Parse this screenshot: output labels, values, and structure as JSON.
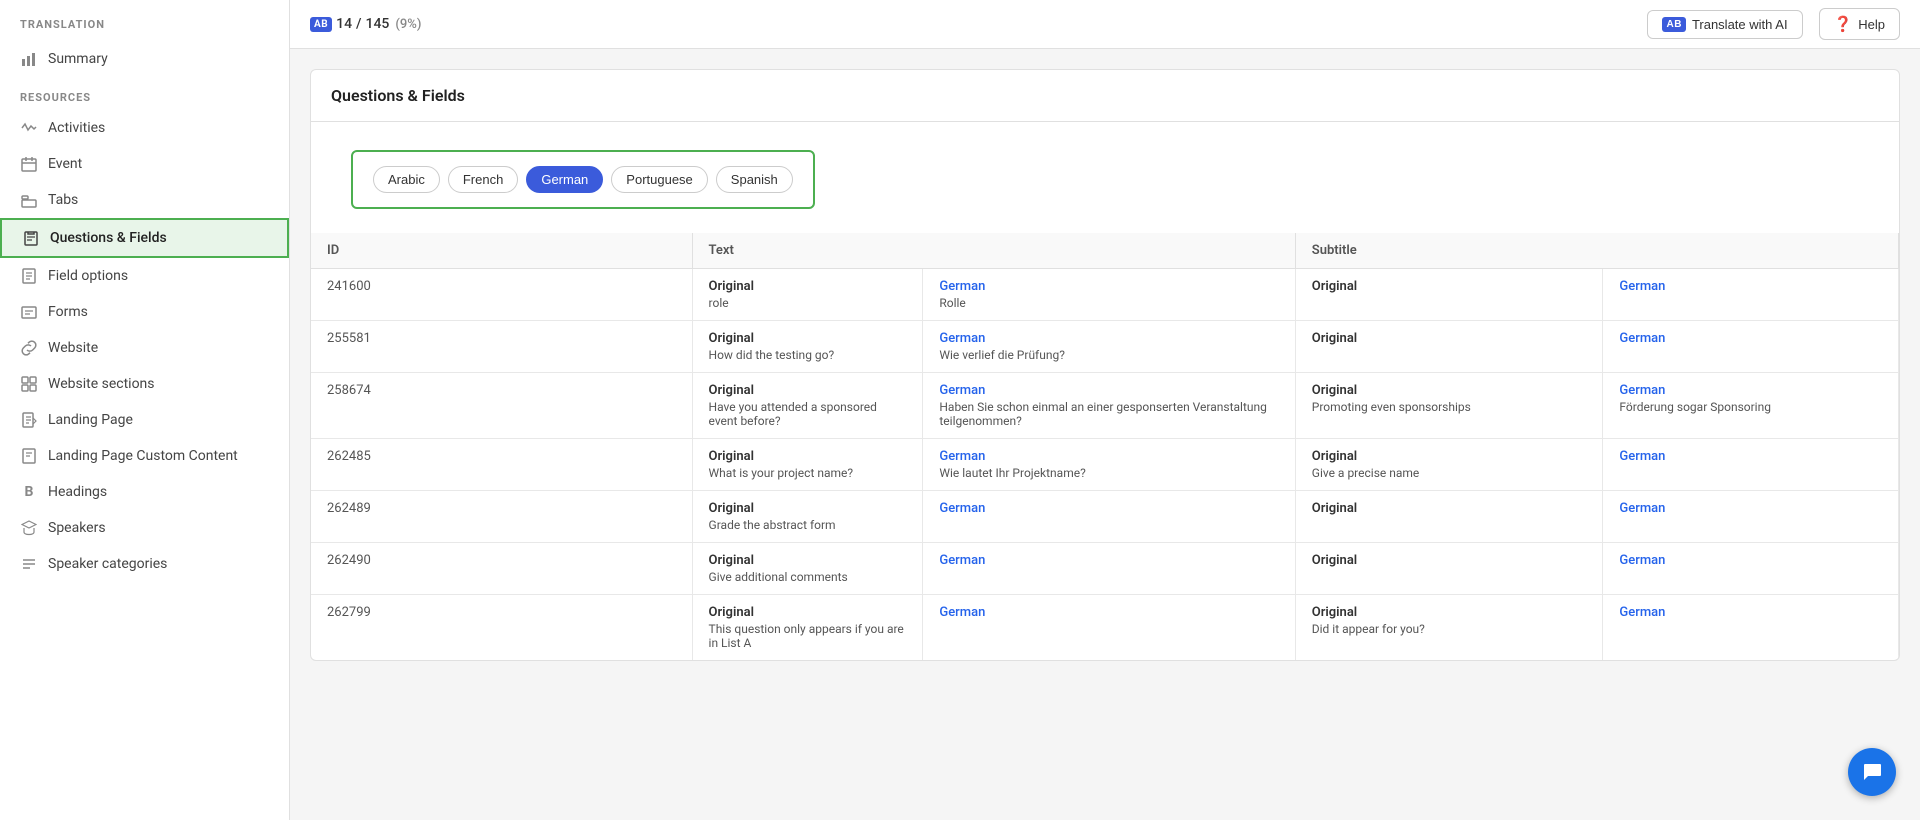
{
  "app": {
    "title": "TRANSLATION"
  },
  "topbar": {
    "progress_count": "14",
    "progress_total": "145",
    "progress_pct": "(9%)",
    "progress_icon": "AB",
    "translate_ai_label": "Translate with AI",
    "translate_ai_icon": "AB",
    "help_label": "Help"
  },
  "sidebar": {
    "summary_label": "Summary",
    "resources_label": "RESOURCES",
    "items": [
      {
        "id": "activities",
        "label": "Activities",
        "icon": "chart"
      },
      {
        "id": "event",
        "label": "Event",
        "icon": "home"
      },
      {
        "id": "tabs",
        "label": "Tabs",
        "icon": "tabs"
      },
      {
        "id": "questions-fields",
        "label": "Questions & Fields",
        "icon": "clipboard",
        "active": true
      },
      {
        "id": "field-options",
        "label": "Field options",
        "icon": "doc"
      },
      {
        "id": "forms",
        "label": "Forms",
        "icon": "forms"
      },
      {
        "id": "website",
        "label": "Website",
        "icon": "link"
      },
      {
        "id": "website-sections",
        "label": "Website sections",
        "icon": "grid"
      },
      {
        "id": "landing-page",
        "label": "Landing Page",
        "icon": "page"
      },
      {
        "id": "landing-page-custom",
        "label": "Landing Page Custom Content",
        "icon": "page2"
      },
      {
        "id": "headings",
        "label": "Headings",
        "icon": "b"
      },
      {
        "id": "speakers",
        "label": "Speakers",
        "icon": "grad"
      },
      {
        "id": "speaker-categories",
        "label": "Speaker categories",
        "icon": "nav"
      }
    ]
  },
  "section": {
    "title": "Questions & Fields",
    "languages": [
      {
        "id": "arabic",
        "label": "Arabic",
        "active": false
      },
      {
        "id": "french",
        "label": "French",
        "active": false
      },
      {
        "id": "german",
        "label": "German",
        "active": true
      },
      {
        "id": "portuguese",
        "label": "Portuguese",
        "active": false
      },
      {
        "id": "spanish",
        "label": "Spanish",
        "active": false
      }
    ],
    "table": {
      "headers": [
        "ID",
        "Text",
        "",
        "Subtitle",
        ""
      ],
      "rows": [
        {
          "id": "241600",
          "text_original": "Original",
          "text_value": "role",
          "text_german_label": "German",
          "text_german_value": "Rolle",
          "subtitle_original": "Original",
          "subtitle_german_label": "German",
          "subtitle_german_value": ""
        },
        {
          "id": "255581",
          "text_original": "Original",
          "text_value": "How did the testing go?",
          "text_german_label": "German",
          "text_german_value": "Wie verlief die Prüfung?",
          "subtitle_original": "Original",
          "subtitle_german_label": "German",
          "subtitle_german_value": ""
        },
        {
          "id": "258674",
          "text_original": "Original",
          "text_value": "Have you attended a sponsored event before?",
          "text_german_label": "German",
          "text_german_value": "Haben Sie schon einmal an einer gesponserten Veranstaltung teilgenommen?",
          "subtitle_original": "Original",
          "subtitle_original_value": "Promoting even sponsorships",
          "subtitle_german_label": "German",
          "subtitle_german_value": "Förderung sogar Sponsoring"
        },
        {
          "id": "262485",
          "text_original": "Original",
          "text_value": "What is your project name?",
          "text_german_label": "German",
          "text_german_value": "Wie lautet Ihr Projektname?",
          "subtitle_original": "Original",
          "subtitle_original_value": "Give a precise name",
          "subtitle_german_label": "German",
          "subtitle_german_value": ""
        },
        {
          "id": "262489",
          "text_original": "Original",
          "text_value": "Grade the abstract form",
          "text_german_label": "German",
          "text_german_value": "",
          "subtitle_original": "Original",
          "subtitle_german_label": "German",
          "subtitle_german_value": ""
        },
        {
          "id": "262490",
          "text_original": "Original",
          "text_value": "Give additional comments",
          "text_german_label": "German",
          "text_german_value": "",
          "subtitle_original": "Original",
          "subtitle_german_label": "German",
          "subtitle_german_value": ""
        },
        {
          "id": "262799",
          "text_original": "Original",
          "text_value": "This question only appears if you are in List A",
          "text_german_label": "German",
          "text_german_value": "",
          "subtitle_original": "Original",
          "subtitle_original_value": "Did it appear for you?",
          "subtitle_german_label": "German",
          "subtitle_german_value": ""
        }
      ]
    }
  }
}
